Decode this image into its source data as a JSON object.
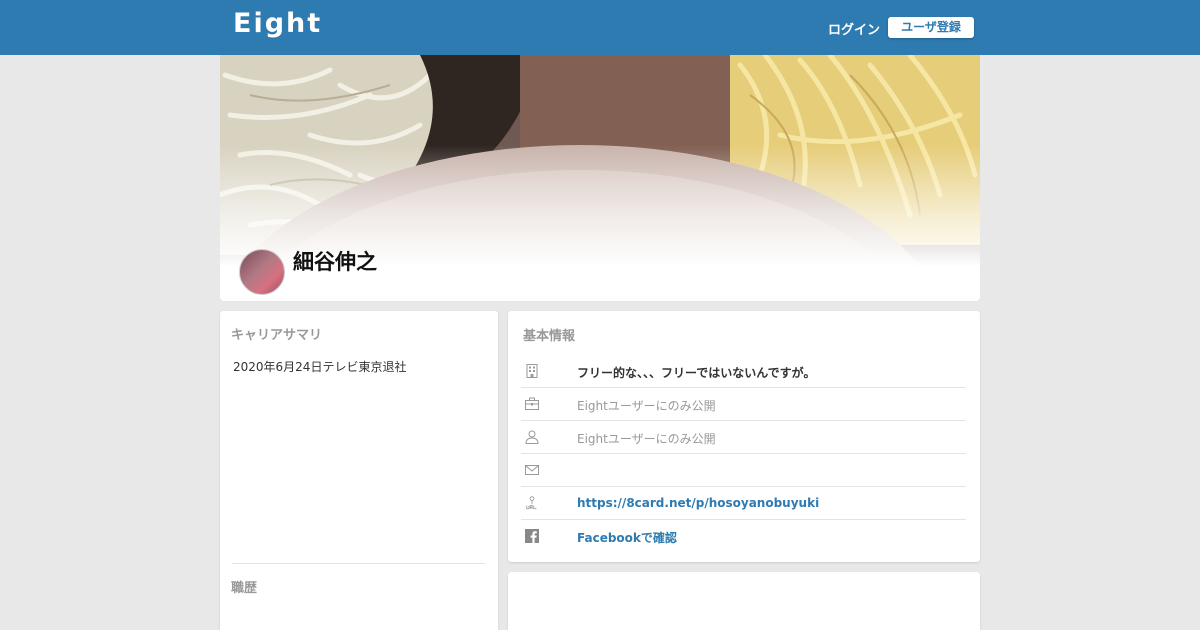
{
  "header": {
    "logo": "Eight",
    "login_label": "ログイン",
    "signup_label": "ユーザ登録"
  },
  "profile": {
    "name": "細谷伸之"
  },
  "career": {
    "summary_title": "キャリアサマリ",
    "summary_text": "2020年6月24日テレビ東京退社",
    "history_title": "職歴"
  },
  "basic_info": {
    "title": "基本情報",
    "rows": [
      {
        "icon": "building-icon",
        "text": "フリー的な、、、フリーではいないんですが。"
      },
      {
        "icon": "briefcase-icon",
        "text": "Eightユーザーにのみ公開"
      },
      {
        "icon": "person-icon",
        "text": "Eightユーザーにのみ公開"
      },
      {
        "icon": "mail-icon",
        "text": ""
      },
      {
        "icon": "url-icon",
        "text": "https://8card.net/p/hosoyanobuyuki"
      },
      {
        "icon": "facebook-icon",
        "text": "Facebookで確認"
      }
    ]
  },
  "colors": {
    "brand": "#2e7bb1",
    "muted": "#999999"
  }
}
